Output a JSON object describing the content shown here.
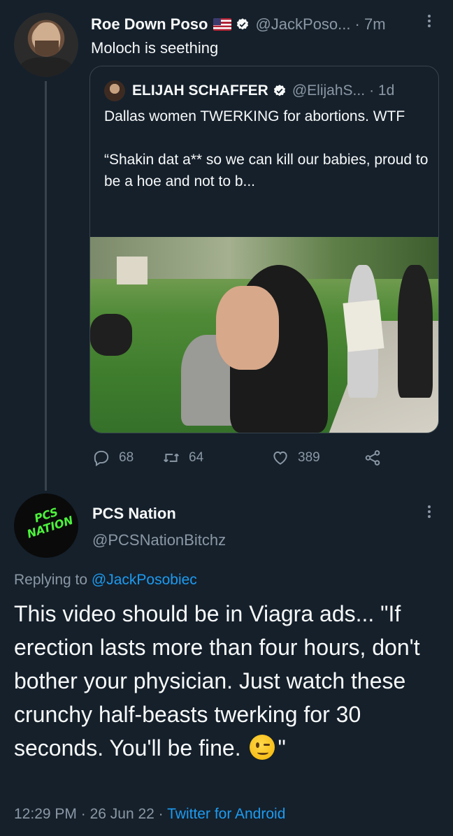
{
  "colors": {
    "background": "#15202b",
    "text": "#f7f9f9",
    "muted": "#8b98a5",
    "accent": "#1d9bf0",
    "border": "#38444d"
  },
  "tweet1": {
    "name": "Roe Down Poso",
    "handle": "@JackPoso...",
    "time": "· 7m",
    "text": "Moloch is seething",
    "icons": [
      "us-flag-icon",
      "verified-badge-icon",
      "more-vertical-icon"
    ]
  },
  "quote": {
    "name": "ELIJAH SCHAFFER",
    "handle": "@ElijahS...",
    "time": "· 1d",
    "text": "Dallas women TWERKING for abortions. WTF\n\n“Shakin dat a** so we can kill our babies, proud to be a hoe and not to b...",
    "media": "video-thumbnail"
  },
  "actions": {
    "replies": "68",
    "retweets": "64",
    "likes": "389"
  },
  "tweet2": {
    "name": "PCS Nation",
    "handle": "@PCSNationBitchz",
    "avatar_text": "PCS NATION",
    "replying_prefix": "Replying to",
    "replying_handle": "@JackPosobiec",
    "text_main": "This video should be in Viagra ads... \"If erection lasts more than four hours, don't bother your physician. Just watch these crunchy half-beasts twerking for 30 seconds. You'll be fine.",
    "text_end": "\"",
    "emoji": "winking-face-emoji",
    "time": "12:29 PM",
    "date": "26 Jun 22",
    "source": "Twitter for Android"
  }
}
